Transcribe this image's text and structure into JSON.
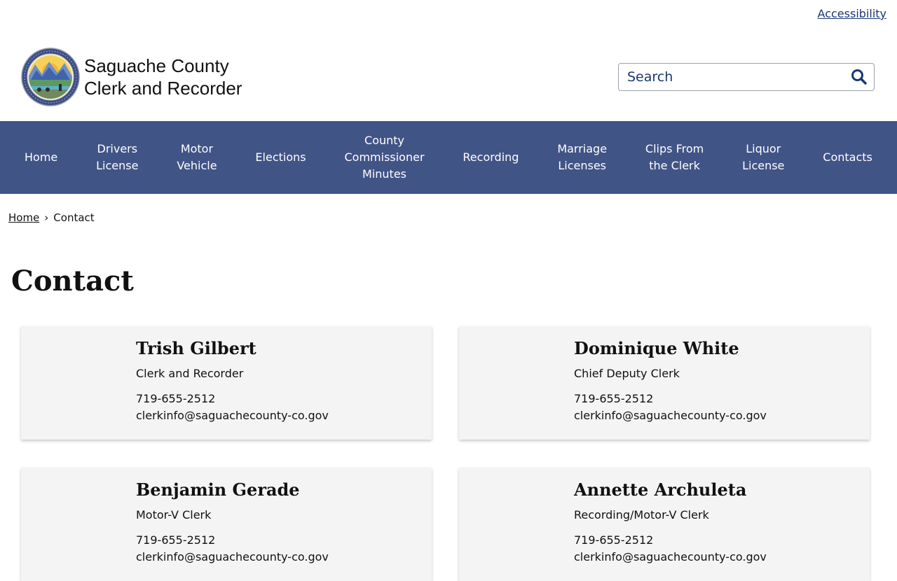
{
  "utility": {
    "accessibility_label": "Accessibility"
  },
  "header": {
    "brand_line1": "Saguache County",
    "brand_line2": "Clerk and Recorder",
    "search_placeholder": "Search",
    "seal_icon": "county-seal-icon"
  },
  "colors": {
    "nav_bg": "#415486",
    "link": "#1a3673",
    "card_bg": "#f4f4f4"
  },
  "nav": {
    "items": [
      {
        "label": "Home"
      },
      {
        "label": "Drivers\nLicense"
      },
      {
        "label": "Motor\nVehicle"
      },
      {
        "label": "Elections"
      },
      {
        "label": "County\nCommissioner\nMinutes"
      },
      {
        "label": "Recording"
      },
      {
        "label": "Marriage\nLicenses"
      },
      {
        "label": "Clips From\nthe Clerk"
      },
      {
        "label": "Liquor\nLicense"
      },
      {
        "label": "Contacts"
      }
    ]
  },
  "breadcrumb": {
    "home": "Home",
    "separator": "›",
    "current": "Contact"
  },
  "page": {
    "title": "Contact"
  },
  "contacts": [
    {
      "name": "Trish Gilbert",
      "role": "Clerk and Recorder",
      "phone": "719-655-2512",
      "email": "clerkinfo@saguachecounty-co.gov"
    },
    {
      "name": "Dominique White",
      "role": "Chief Deputy Clerk",
      "phone": "719-655-2512",
      "email": "clerkinfo@saguachecounty-co.gov"
    },
    {
      "name": "Benjamin Gerade",
      "role": "Motor-V Clerk",
      "phone": "719-655-2512",
      "email": "clerkinfo@saguachecounty-co.gov"
    },
    {
      "name": "Annette Archuleta",
      "role": "Recording/Motor-V Clerk",
      "phone": "719-655-2512",
      "email": "clerkinfo@saguachecounty-co.gov"
    }
  ]
}
